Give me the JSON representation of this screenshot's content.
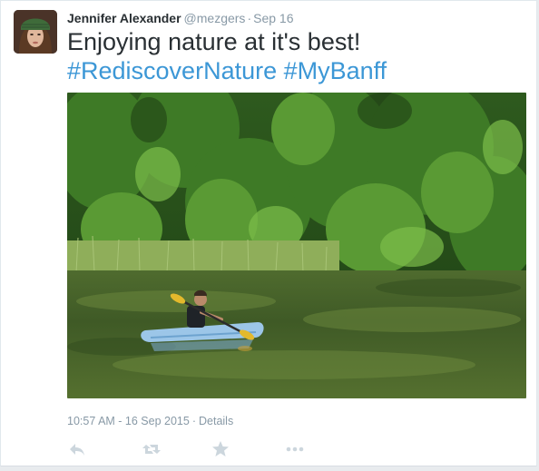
{
  "tweet": {
    "author": {
      "fullname": "Jennifer Alexander",
      "username": "@mezgers"
    },
    "separator": "·",
    "timestamp_short": "Sep 16",
    "text": "Enjoying nature at it's best!",
    "hashtags": [
      "#RediscoverNature",
      "#MyBanff"
    ],
    "footer": {
      "time": "10:57 AM - 16 Sep 2015",
      "separator": "·",
      "details_label": "Details"
    },
    "actions": [
      {
        "name": "reply-icon"
      },
      {
        "name": "retweet-icon"
      },
      {
        "name": "favorite-star-icon"
      },
      {
        "name": "more-options-icon"
      }
    ]
  },
  "colors": {
    "link": "#3c97d6",
    "text": "#292f33",
    "muted": "#8899a6",
    "icon": "#ccd6dd"
  }
}
